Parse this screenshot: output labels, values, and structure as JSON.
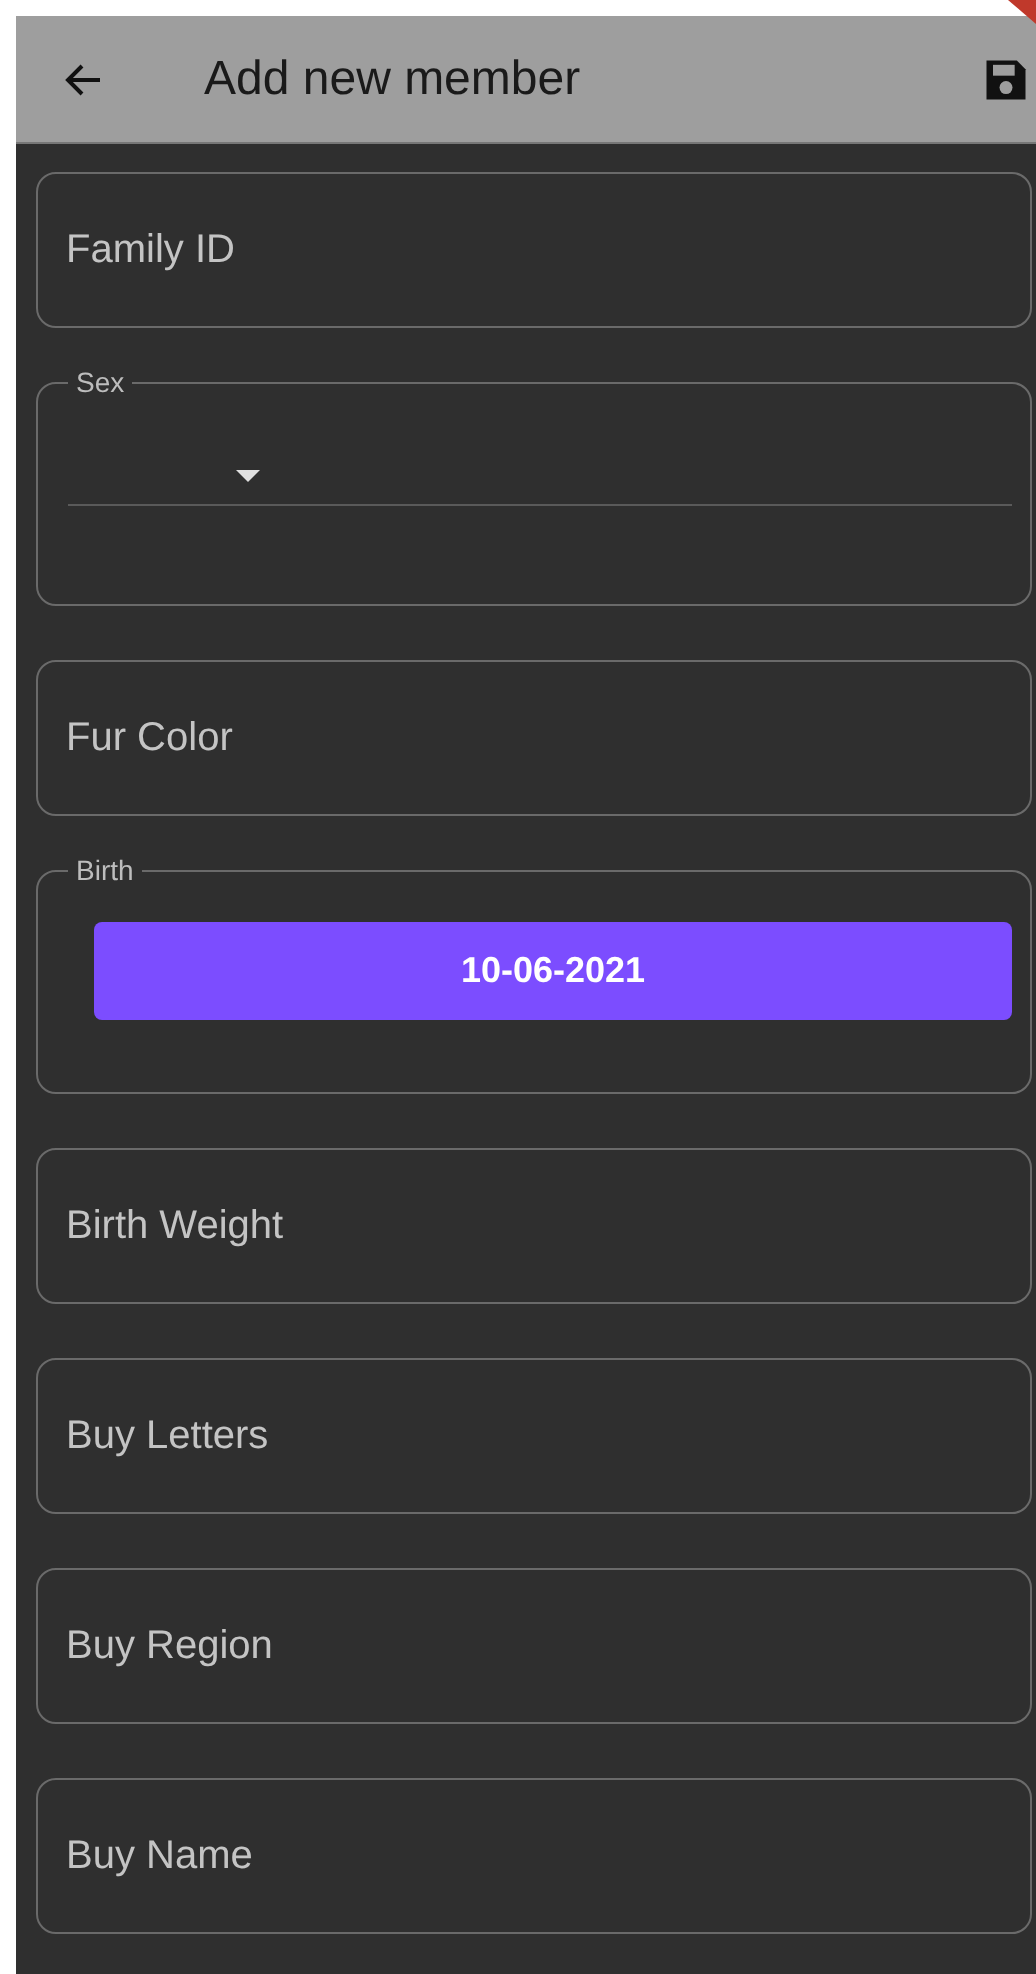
{
  "app_bar": {
    "title": "Add new member"
  },
  "fields": [
    {
      "kind": "text",
      "placeholder": "Family ID"
    },
    {
      "kind": "dropdown",
      "label": "Sex"
    },
    {
      "kind": "text",
      "placeholder": "Fur Color"
    },
    {
      "kind": "date",
      "label": "Birth",
      "value": "10-06-2021"
    },
    {
      "kind": "text",
      "placeholder": "Birth Weight"
    },
    {
      "kind": "text",
      "placeholder": "Buy Letters"
    },
    {
      "kind": "text",
      "placeholder": "Buy Region"
    },
    {
      "kind": "text",
      "placeholder": "Buy Name"
    }
  ]
}
